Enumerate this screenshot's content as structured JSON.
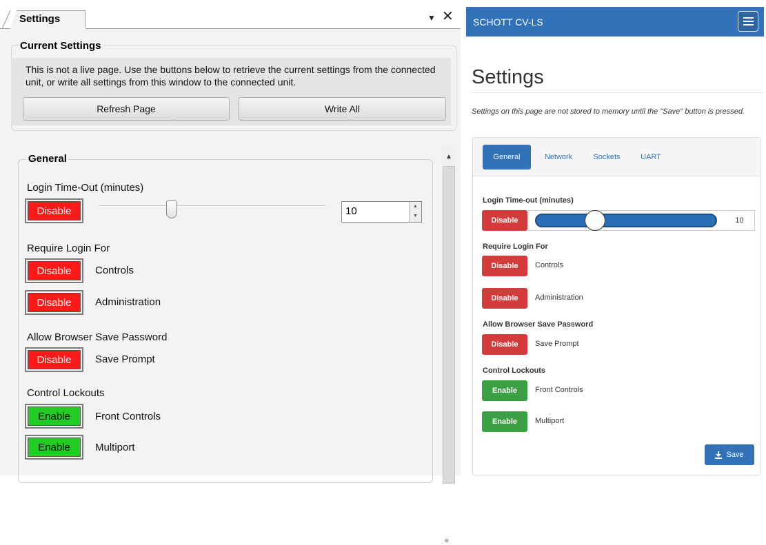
{
  "desktop": {
    "tab": {
      "label": "Settings",
      "menu_glyph": "▼",
      "close_glyph": "✕"
    },
    "current_settings": {
      "title": "Current Settings",
      "info": "This is not a live page. Use the buttons below to retrieve the current settings from the connected unit, or write all settings from this window to the connected unit.",
      "refresh_label": "Refresh Page",
      "write_all_label": "Write All"
    },
    "general": {
      "title": "General",
      "login_timeout_label": "Login Time-Out (minutes)",
      "login_timeout_toggle": "Disable",
      "login_timeout_value": "10",
      "require_login_label": "Require Login For",
      "controls_toggle": "Disable",
      "controls_label": "Controls",
      "administration_toggle": "Disable",
      "administration_label": "Administration",
      "browser_save_label": "Allow Browser Save Password",
      "save_prompt_toggle": "Disable",
      "save_prompt_label": "Save Prompt",
      "control_lockouts_label": "Control Lockouts",
      "front_controls_toggle": "Enable",
      "front_controls_label": "Front Controls",
      "multiport_toggle": "Enable",
      "multiport_label": "Multiport"
    }
  },
  "web": {
    "brand": "SCHOTT CV-LS",
    "page_title": "Settings",
    "note": "Settings on this page are not stored to memory until the \"Save\" button is pressed.",
    "tabs": [
      {
        "label": "General",
        "active": true
      },
      {
        "label": "Network",
        "active": false
      },
      {
        "label": "Sockets",
        "active": false
      },
      {
        "label": "UART",
        "active": false
      }
    ],
    "login_timeout_label": "Login Time-out (minutes)",
    "login_timeout_toggle": "Disable",
    "login_timeout_value": "10",
    "require_login_label": "Require Login For",
    "controls_toggle": "Disable",
    "controls_label": "Controls",
    "administration_toggle": "Disable",
    "administration_label": "Administration",
    "browser_save_label": "Allow Browser Save Password",
    "save_prompt_toggle": "Disable",
    "save_prompt_label": "Save Prompt",
    "control_lockouts_label": "Control Lockouts",
    "front_controls_toggle": "Enable",
    "front_controls_label": "Front Controls",
    "multiport_toggle": "Enable",
    "multiport_label": "Multiport",
    "save_label": "Save",
    "save_icon": "download-icon"
  },
  "colors": {
    "disable_red_desktop": "#ff1a1a",
    "enable_green_desktop": "#22cc22",
    "web_blue": "#3272b8",
    "web_red": "#d43c3c",
    "web_green": "#3aa043"
  }
}
